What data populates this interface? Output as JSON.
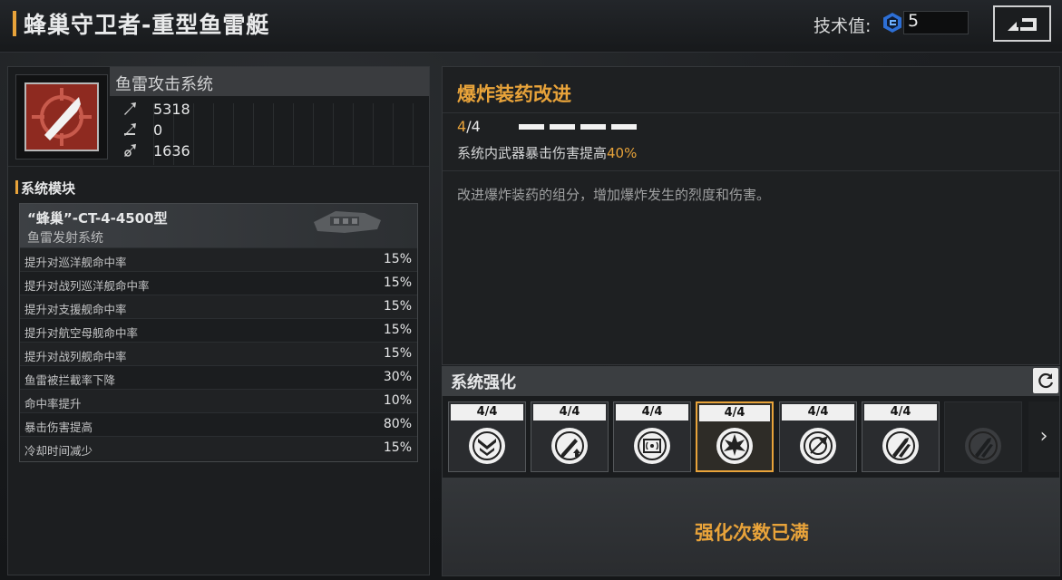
{
  "header": {
    "title": "蜂巢守卫者-重型鱼雷艇",
    "tech_label": "技术值:",
    "tech_value": "5",
    "tech_icon": "tech-point-icon",
    "back_icon": "return-icon"
  },
  "system": {
    "name": "鱼雷攻击系统",
    "icon": "torpedo-crosshair-icon",
    "stats": [
      {
        "icon": "attack-stat-icon",
        "value": "5318"
      },
      {
        "icon": "penetration-stat-icon",
        "value": "0"
      },
      {
        "icon": "structure-stat-icon",
        "value": "1636"
      }
    ]
  },
  "modules": {
    "section_title": "系统模块",
    "module_name": "“蜂巢”-CT-4-4500型",
    "module_sub": "鱼雷发射系统",
    "rows": [
      {
        "label": "提升对巡洋舰命中率",
        "value": "15%"
      },
      {
        "label": "提升对战列巡洋舰命中率",
        "value": "15%"
      },
      {
        "label": "提升对支援舰命中率",
        "value": "15%"
      },
      {
        "label": "提升对航空母舰命中率",
        "value": "15%"
      },
      {
        "label": "提升对战列舰命中率",
        "value": "15%"
      },
      {
        "label": "鱼雷被拦截率下降",
        "value": "30%"
      },
      {
        "label": "命中率提升",
        "value": "10%"
      },
      {
        "label": "暴击伤害提高",
        "value": "80%"
      },
      {
        "label": "冷却时间减少",
        "value": "15%"
      }
    ]
  },
  "upgrade": {
    "title": "爆炸装药改进",
    "level_current": "4",
    "level_max": "/4",
    "pips_filled": 4,
    "pips_total": 4,
    "effect_prefix": "系统内武器暴击伤害提高",
    "effect_value": "40%",
    "description": "改进爆炸装药的组分，增加爆炸发生的烈度和伤害。"
  },
  "enhance": {
    "title": "系统强化",
    "refresh_icon": "refresh-icon",
    "slots": [
      {
        "level": "4/4",
        "icon": "chevron-shield-icon"
      },
      {
        "level": "4/4",
        "icon": "pen-upgrade-icon"
      },
      {
        "level": "4/4",
        "icon": "chip-signal-icon"
      },
      {
        "level": "4/4",
        "icon": "explosion-icon",
        "selected": true
      },
      {
        "level": "4/4",
        "icon": "target-arrow-icon"
      },
      {
        "level": "4/4",
        "icon": "missile-pod-icon"
      },
      {
        "level": "",
        "icon": "locked-missile-icon",
        "locked": true
      }
    ],
    "next_label": "›",
    "max_text": "强化次数已满"
  }
}
